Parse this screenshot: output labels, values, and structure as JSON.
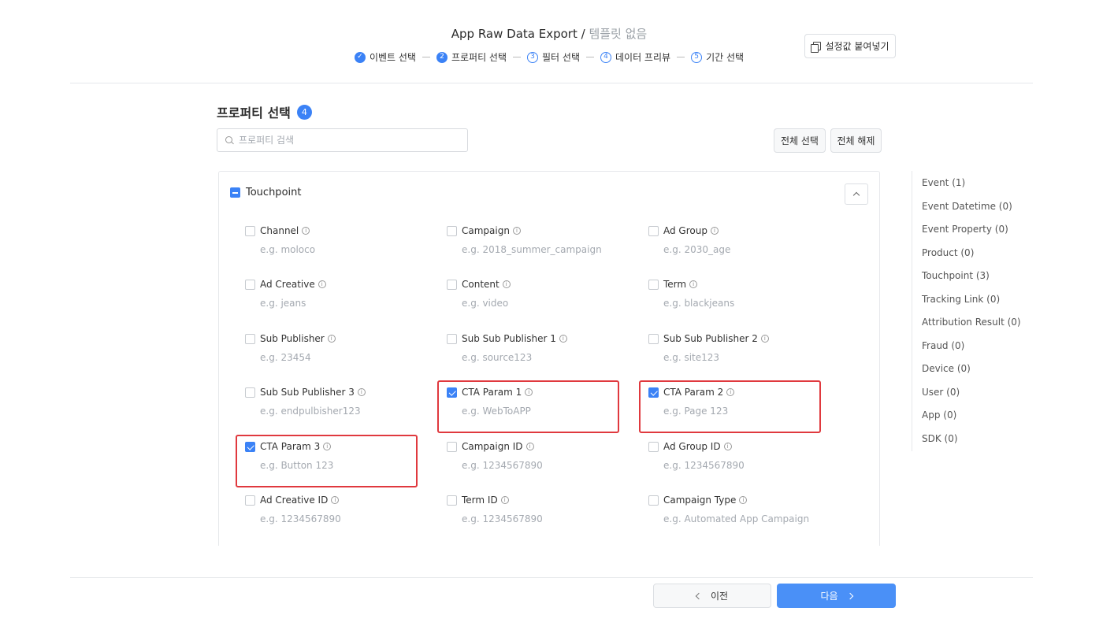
{
  "header": {
    "title": "App Raw Data Export",
    "separator": " / ",
    "template": "템플릿 없음",
    "paste_label": "설정값 붙여넣기",
    "steps": [
      {
        "num": "✓",
        "label": "이벤트 선택",
        "state": "done"
      },
      {
        "num": "2",
        "label": "프로퍼티 선택",
        "state": "active"
      },
      {
        "num": "3",
        "label": "필터 선택",
        "state": "todo"
      },
      {
        "num": "4",
        "label": "데이터 프리뷰",
        "state": "todo"
      },
      {
        "num": "5",
        "label": "기간 선택",
        "state": "todo"
      }
    ]
  },
  "section": {
    "title": "프로퍼티 선택",
    "count": "4",
    "search_placeholder": "프로퍼티 검색",
    "select_all": "전체 선택",
    "deselect_all": "전체 해제"
  },
  "group": {
    "name": "Touchpoint",
    "properties": [
      {
        "label": "Channel",
        "example": "e.g. moloco",
        "checked": false,
        "highlight": false
      },
      {
        "label": "Campaign",
        "example": "e.g. 2018_summer_campaign",
        "checked": false,
        "highlight": false
      },
      {
        "label": "Ad Group",
        "example": "e.g. 2030_age",
        "checked": false,
        "highlight": false
      },
      {
        "label": "Ad Creative",
        "example": "e.g. jeans",
        "checked": false,
        "highlight": false
      },
      {
        "label": "Content",
        "example": "e.g. video",
        "checked": false,
        "highlight": false
      },
      {
        "label": "Term",
        "example": "e.g. blackjeans",
        "checked": false,
        "highlight": false
      },
      {
        "label": "Sub Publisher",
        "example": "e.g. 23454",
        "checked": false,
        "highlight": false
      },
      {
        "label": "Sub Sub Publisher 1",
        "example": "e.g. source123",
        "checked": false,
        "highlight": false
      },
      {
        "label": "Sub Sub Publisher 2",
        "example": "e.g. site123",
        "checked": false,
        "highlight": false
      },
      {
        "label": "Sub Sub Publisher 3",
        "example": "e.g. endpulbisher123",
        "checked": false,
        "highlight": false
      },
      {
        "label": "CTA Param 1",
        "example": "e.g. WebToAPP",
        "checked": true,
        "highlight": true
      },
      {
        "label": "CTA Param 2",
        "example": "e.g. Page 123",
        "checked": true,
        "highlight": true
      },
      {
        "label": "CTA Param 3",
        "example": "e.g. Button 123",
        "checked": true,
        "highlight": true
      },
      {
        "label": "Campaign ID",
        "example": "e.g. 1234567890",
        "checked": false,
        "highlight": false
      },
      {
        "label": "Ad Group ID",
        "example": "e.g. 1234567890",
        "checked": false,
        "highlight": false
      },
      {
        "label": "Ad Creative ID",
        "example": "e.g. 1234567890",
        "checked": false,
        "highlight": false
      },
      {
        "label": "Term ID",
        "example": "e.g. 1234567890",
        "checked": false,
        "highlight": false
      },
      {
        "label": "Campaign Type",
        "example": "e.g. Automated App Campaign",
        "checked": false,
        "highlight": false
      }
    ]
  },
  "categories": [
    "Event (1)",
    "Event Datetime (0)",
    "Event Property (0)",
    "Product (0)",
    "Touchpoint (3)",
    "Tracking Link (0)",
    "Attribution Result (0)",
    "Fraud (0)",
    "Device (0)",
    "User (0)",
    "App (0)",
    "SDK (0)"
  ],
  "footer": {
    "prev_label": "이전",
    "next_label": "다음"
  }
}
